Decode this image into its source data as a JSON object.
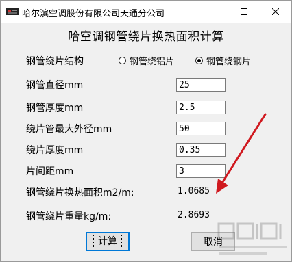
{
  "window": {
    "title": "哈尔滨空调股份有限公司天通分公司"
  },
  "heading": "哈空调钢管绕片换热面积计算",
  "structure": {
    "label": "钢管绕片结构",
    "options": [
      {
        "label": "钢管绕铝片",
        "checked": false
      },
      {
        "label": "钢管绕钢片",
        "checked": true
      }
    ]
  },
  "fields": [
    {
      "label": "钢管直径mm",
      "value": "25"
    },
    {
      "label": "钢管厚度mm",
      "value": "2.5"
    },
    {
      "label": "绕片管最大外径mm",
      "value": "50"
    },
    {
      "label": "绕片厚度mm",
      "value": "0.35"
    },
    {
      "label": "片间距mm",
      "value": "3"
    }
  ],
  "results": [
    {
      "label": "钢管绕片换热面积m2/m:",
      "value": "1.0685"
    },
    {
      "label": "钢管绕片重量kg/m:",
      "value": "2.8693"
    }
  ],
  "buttons": {
    "calculate": "计算",
    "cancel": "取消"
  },
  "colors": {
    "annotation_arrow": "#d0191f",
    "default_button_border": "#0078d7",
    "window_bg": "#f0f0f0"
  }
}
